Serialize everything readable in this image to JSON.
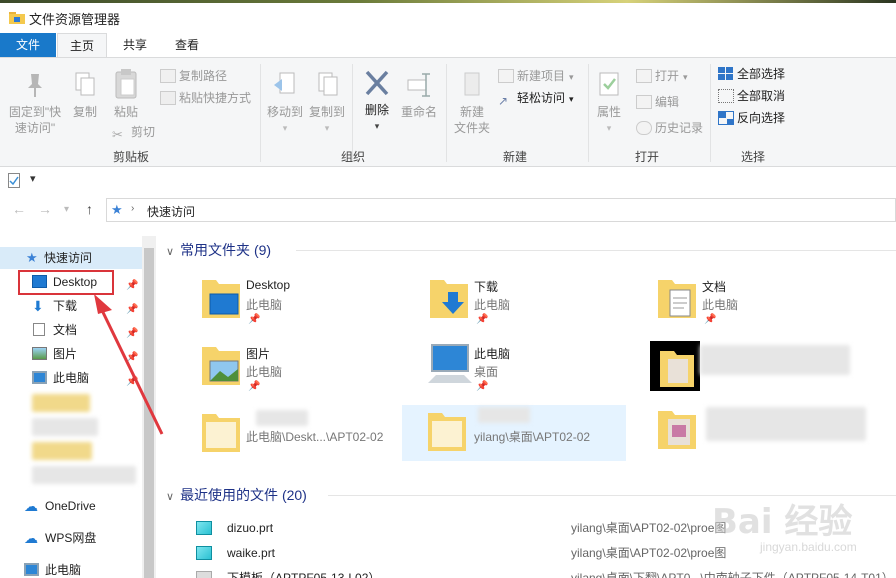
{
  "window": {
    "title": "文件资源管理器"
  },
  "tabs": {
    "file": "文件",
    "home": "主页",
    "share": "共享",
    "view": "查看"
  },
  "ribbon": {
    "clipboard": {
      "group_label": "剪贴板",
      "pin_label_line1": "固定到\"快",
      "pin_label_line2": "速访问\"",
      "copy": "复制",
      "paste": "粘贴",
      "copy_path": "复制路径",
      "paste_shortcut": "粘贴快捷方式",
      "cut": "剪切"
    },
    "organize": {
      "group_label": "组织",
      "move_to": "移动到",
      "copy_to": "复制到",
      "delete": "删除",
      "rename": "重命名"
    },
    "new": {
      "group_label": "新建",
      "new_folder_line1": "新建",
      "new_folder_line2": "文件夹",
      "new_item": "新建项目",
      "easy_access": "轻松访问"
    },
    "open": {
      "group_label": "打开",
      "properties": "属性",
      "open": "打开",
      "edit": "编辑",
      "history": "历史记录"
    },
    "select": {
      "group_label": "选择",
      "select_all": "全部选择",
      "select_none": "全部取消",
      "invert": "反向选择"
    }
  },
  "address": {
    "path": "快速访问"
  },
  "nav": {
    "quick_access": "快速访问",
    "items": [
      {
        "label": "Desktop"
      },
      {
        "label": "下载"
      },
      {
        "label": "文档"
      },
      {
        "label": "图片"
      },
      {
        "label": "此电脑"
      }
    ],
    "onedrive": "OneDrive",
    "wps": "WPS网盘",
    "this_pc": "此电脑"
  },
  "frequent": {
    "header": "常用文件夹 (9)",
    "tiles": [
      {
        "name": "Desktop",
        "location": "此电脑"
      },
      {
        "name": "下载",
        "location": "此电脑"
      },
      {
        "name": "文档",
        "location": "此电脑"
      },
      {
        "name": "图片",
        "location": "此电脑"
      },
      {
        "name": "此电脑",
        "location": "桌面"
      },
      {
        "name": "",
        "location": "此电脑\\Deskt...\\APT02-02"
      },
      {
        "name": "",
        "location": "yilang\\桌面\\APT02-02"
      }
    ]
  },
  "recent": {
    "header": "最近使用的文件 (20)",
    "files": [
      {
        "name": "dizuo.prt",
        "path": "yilang\\桌面\\APT02-02\\proe图"
      },
      {
        "name": "waike.prt",
        "path": "yilang\\桌面\\APT02-02\\proe图"
      },
      {
        "name": "下模板（APTPF05-13-L02）",
        "path": "yilang\\桌面\\下翻\\APT0...\\中南轴子下件（APTPF05-14-T01）"
      }
    ]
  },
  "watermark": {
    "main": "Bai 经验",
    "sub": "jingyan.baidu.com"
  },
  "colors": {
    "file_tab": "#1979ca",
    "highlight": "#d9343a",
    "section_header": "#1e3287",
    "selection": "#e5f3ff"
  }
}
